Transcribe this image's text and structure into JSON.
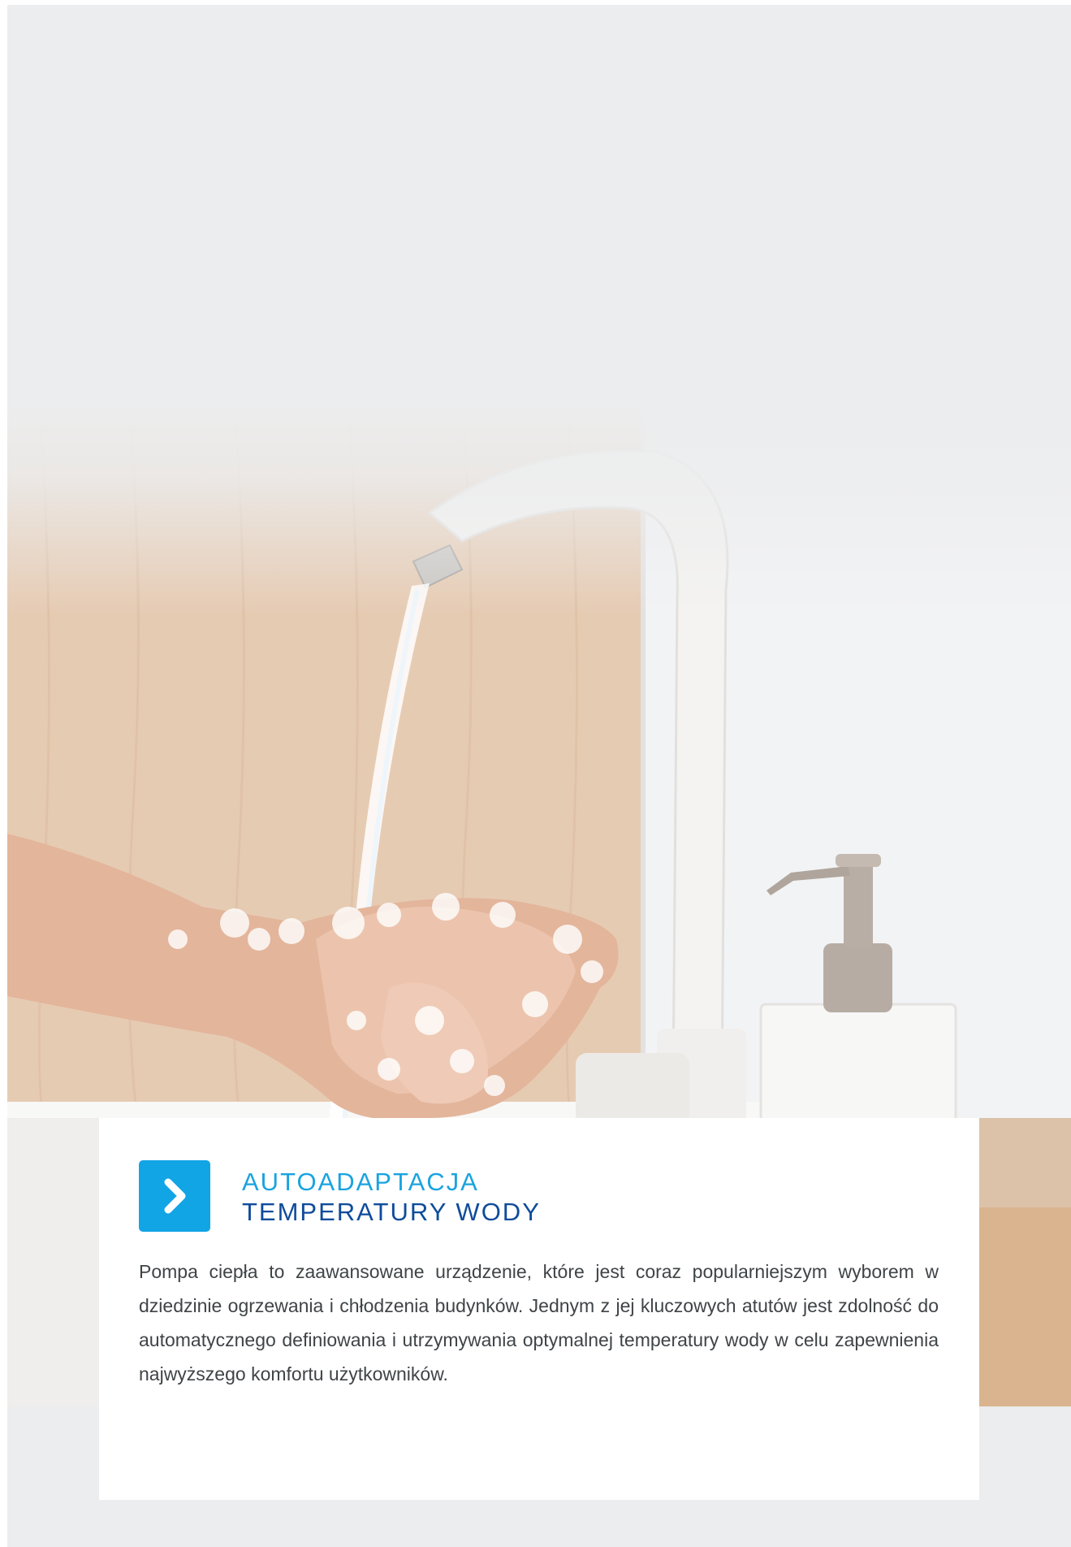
{
  "card": {
    "title_line1": "AUTOADAPTACJA",
    "title_line2": "TEMPERATURY WODY",
    "icon": "chevron-right-icon",
    "body": "Pompa ciepła to zaawansowane urządzenie, które jest coraz popularniejszym wyborem w dziedzinie ogrzewania i chłodzenia budynków. Jednym z jej kluczowych atutów jest zdolność do automatycznego definiowania i utrzymywania optymalnej temperatury wody w celu zapewnienia najwyższego komfortu użytkowników."
  },
  "colors": {
    "background": "#ecedee",
    "accent_light": "#1aa3e0",
    "accent_dark": "#0f4c9a",
    "icon_box": "#12a5e6",
    "text": "#3f4447"
  }
}
